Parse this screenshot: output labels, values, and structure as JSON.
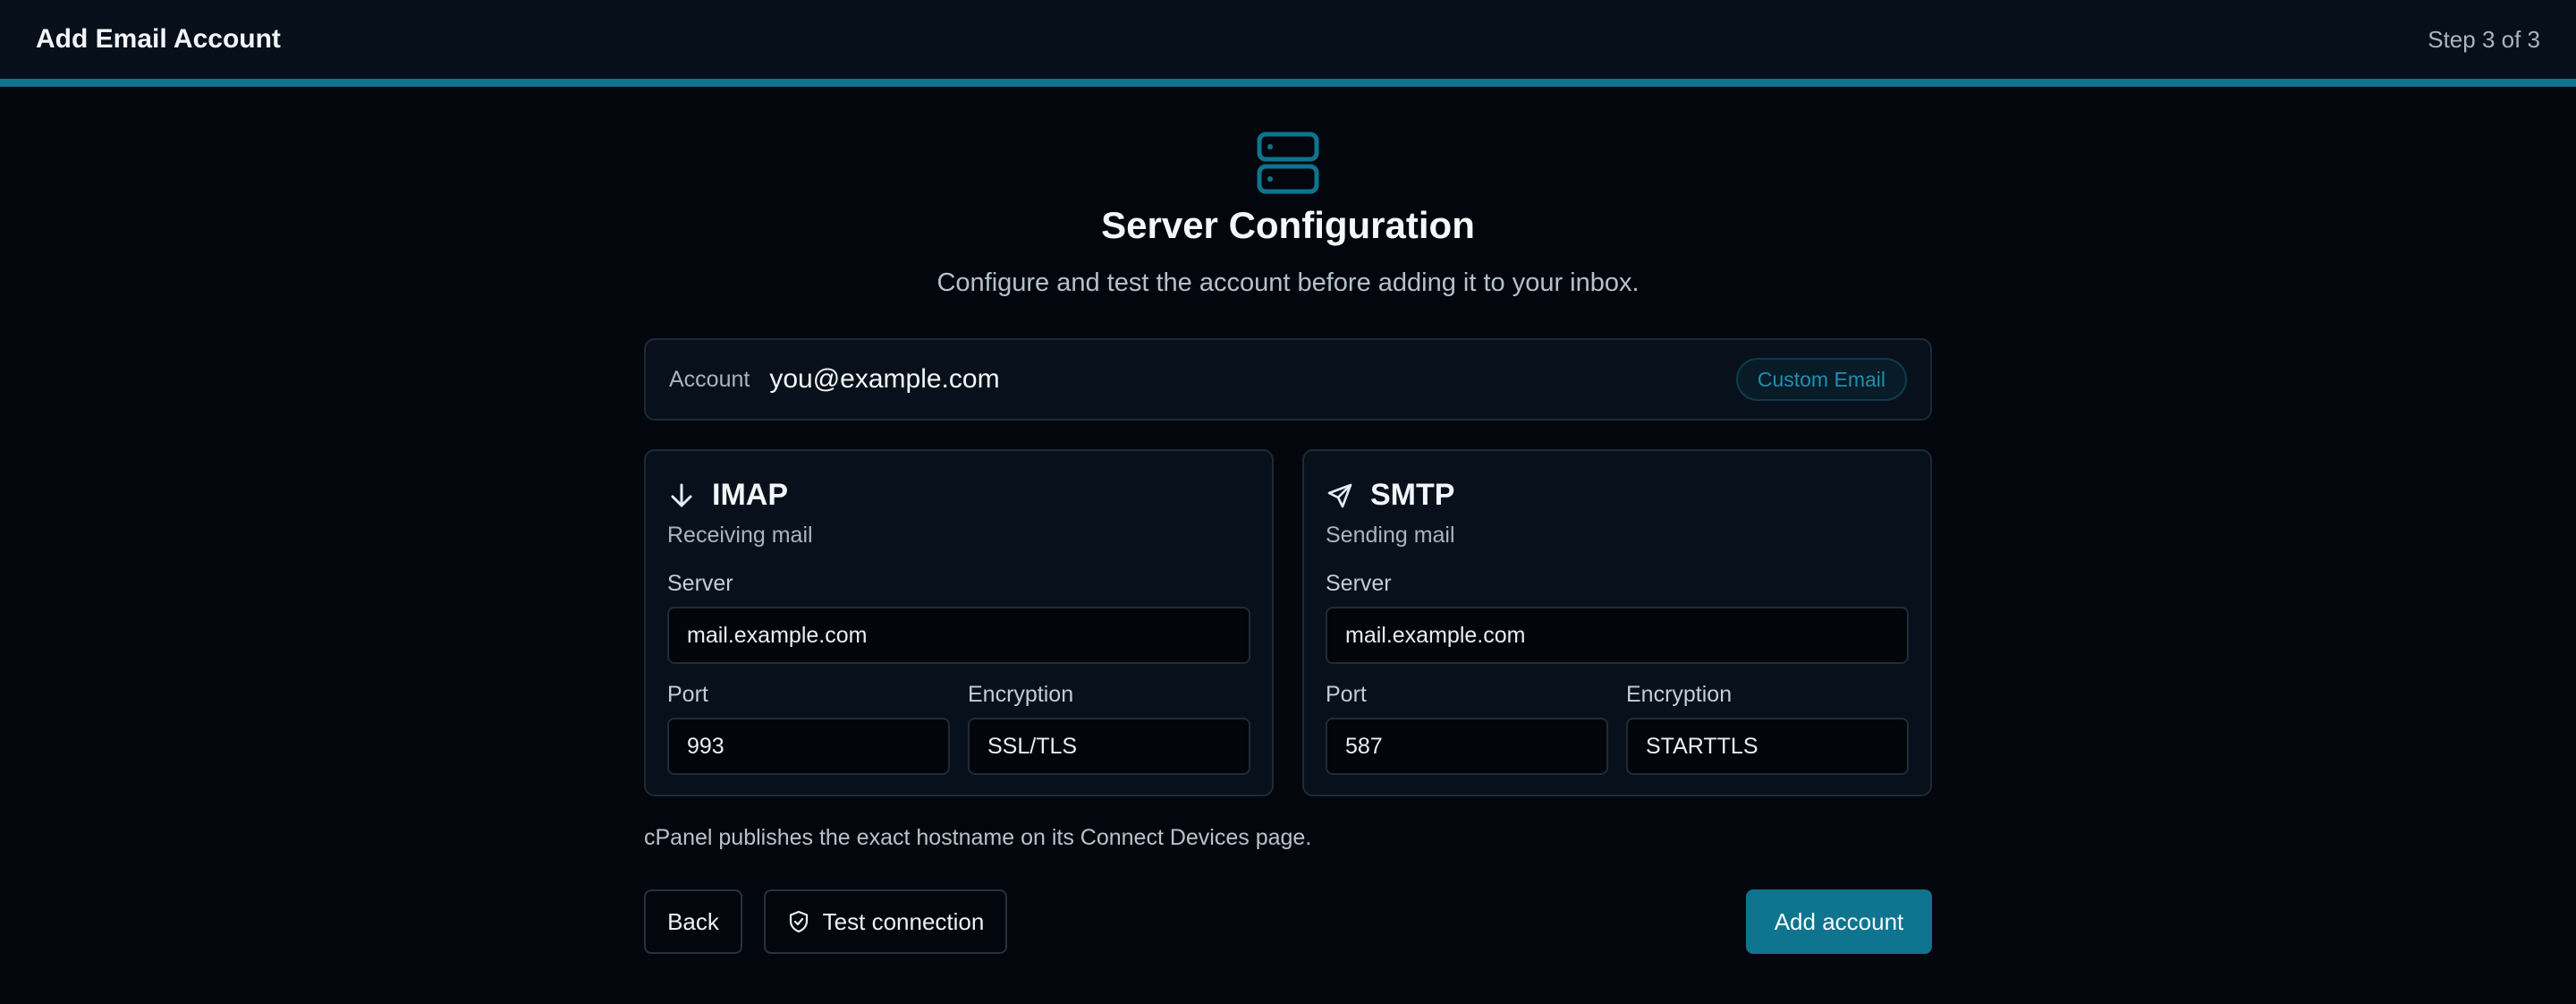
{
  "header": {
    "title": "Add Email Account",
    "step": "Step 3 of 3"
  },
  "progress": 1.0,
  "hero": {
    "icon": "server-icon",
    "title": "Server Configuration",
    "subtitle": "Configure and test the account before adding it to your inbox."
  },
  "account": {
    "label": "Account",
    "email": "you@example.com",
    "badge": "Custom Email"
  },
  "imap": {
    "icon": "arrow-down-icon",
    "title": "IMAP",
    "subtitle": "Receiving mail",
    "server_label": "Server",
    "server": "mail.example.com",
    "port_label": "Port",
    "port": "993",
    "encryption_label": "Encryption",
    "encryption": "SSL/TLS"
  },
  "smtp": {
    "icon": "send-icon",
    "title": "SMTP",
    "subtitle": "Sending mail",
    "server_label": "Server",
    "server": "mail.example.com",
    "port_label": "Port",
    "port": "587",
    "encryption_label": "Encryption",
    "encryption": "STARTTLS"
  },
  "hint": "cPanel publishes the exact hostname on its Connect Devices page.",
  "actions": {
    "back": "Back",
    "test": "Test connection",
    "test_icon": "shield-check-icon",
    "add": "Add account"
  },
  "colors": {
    "accent": "#0e7490",
    "background": "#03070d",
    "panel": "#08111b",
    "border": "#1e2a37"
  }
}
